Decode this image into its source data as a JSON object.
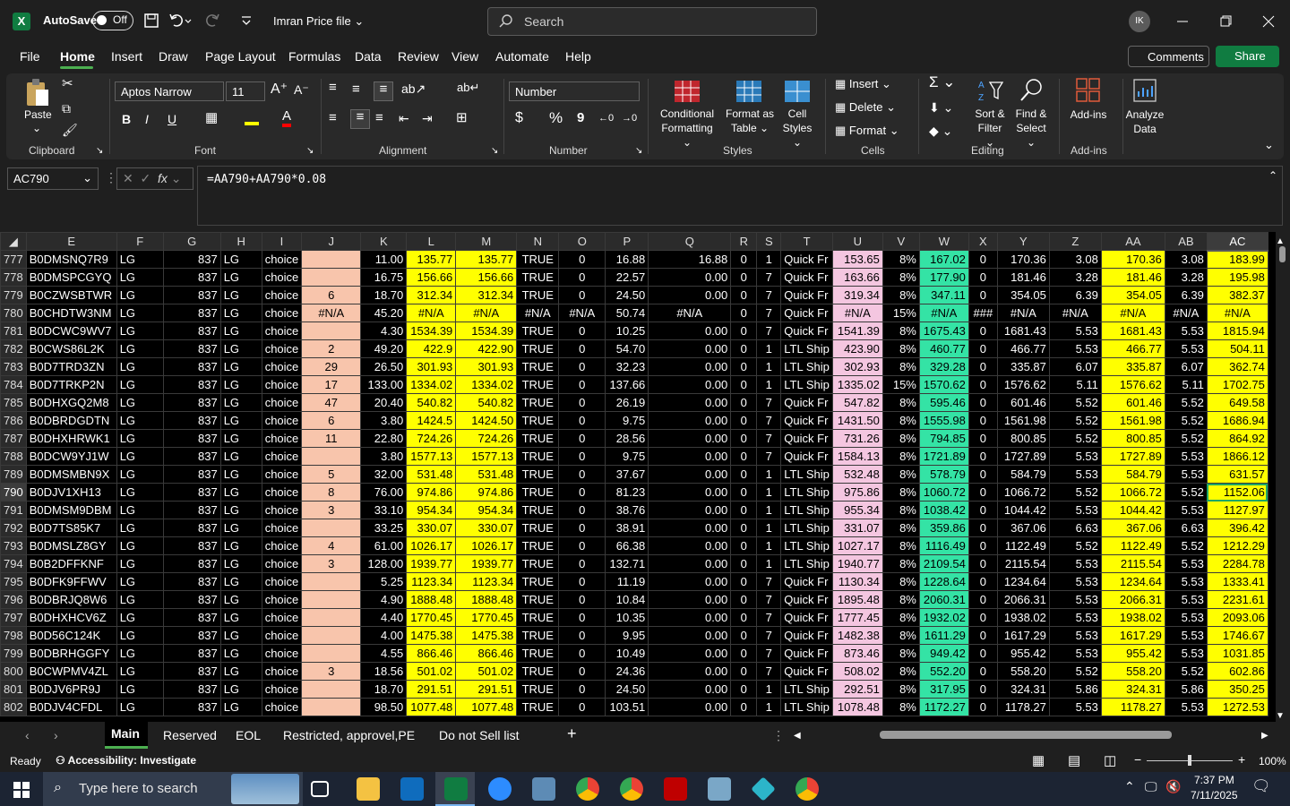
{
  "titlebar": {
    "app_icon": "X",
    "autosave_label": "AutoSave",
    "autosave_state": "Off",
    "filename": "Imran Price file",
    "search_placeholder": "Search",
    "avatar": "IK"
  },
  "menu": [
    "File",
    "Home",
    "Insert",
    "Draw",
    "Page Layout",
    "Formulas",
    "Data",
    "Review",
    "View",
    "Automate",
    "Help"
  ],
  "menu_buttons": {
    "comments": "Comments",
    "share": "Share"
  },
  "ribbon": {
    "clipboard": {
      "paste": "Paste",
      "label": "Clipboard"
    },
    "font": {
      "name": "Aptos Narrow",
      "size": "11",
      "label": "Font"
    },
    "alignment": {
      "label": "Alignment"
    },
    "number": {
      "format": "Number",
      "label": "Number",
      "currency": "$",
      "percent": "%",
      "comma": "9"
    },
    "styles": {
      "conditional": "Conditional",
      "conditional2": "Formatting",
      "format_table": "Format as",
      "format_table2": "Table",
      "cell_styles": "Cell",
      "cell_styles2": "Styles",
      "label": "Styles"
    },
    "cells": {
      "insert": "Insert",
      "delete": "Delete",
      "format": "Format",
      "label": "Cells"
    },
    "editing": {
      "sort": "Sort &",
      "sort2": "Filter",
      "find": "Find &",
      "find2": "Select",
      "label": "Editing"
    },
    "addins": {
      "addins": "Add-ins",
      "label": "Add-ins",
      "analyze": "Analyze",
      "analyze2": "Data"
    }
  },
  "formula_bar": {
    "cell": "AC790",
    "fx": "fx",
    "formula": "=AA790+AA790*0.08"
  },
  "columns": [
    "E",
    "F",
    "G",
    "H",
    "I",
    "J",
    "K",
    "L",
    "M",
    "N",
    "O",
    "P",
    "Q",
    "R",
    "S",
    "T",
    "U",
    "V",
    "W",
    "X",
    "Y",
    "Z",
    "AA",
    "AB",
    "AC"
  ],
  "rows": [
    {
      "r": "777",
      "d": [
        "B0DMSNQ7R9",
        "LG",
        "837",
        "LG",
        "choice",
        "",
        "11.00",
        "135.77",
        "135.77",
        "TRUE",
        "0",
        "16.88",
        "16.88",
        "0",
        "1",
        "Quick Fr",
        "153.65",
        "8%",
        "167.02",
        "0",
        "170.36",
        "3.08",
        "170.36",
        "3.08",
        "183.99"
      ]
    },
    {
      "r": "778",
      "d": [
        "B0DMSPCGYQ",
        "LG",
        "837",
        "LG",
        "choice",
        "",
        "16.75",
        "156.66",
        "156.66",
        "TRUE",
        "0",
        "22.57",
        "0.00",
        "0",
        "7",
        "Quick Fr",
        "163.66",
        "8%",
        "177.90",
        "0",
        "181.46",
        "3.28",
        "181.46",
        "3.28",
        "195.98"
      ]
    },
    {
      "r": "779",
      "d": [
        "B0CZWSBTWR",
        "LG",
        "837",
        "LG",
        "choice",
        "6",
        "18.70",
        "312.34",
        "312.34",
        "TRUE",
        "0",
        "24.50",
        "0.00",
        "0",
        "7",
        "Quick Fr",
        "319.34",
        "8%",
        "347.11",
        "0",
        "354.05",
        "6.39",
        "354.05",
        "6.39",
        "382.37"
      ]
    },
    {
      "r": "780",
      "d": [
        "B0CHDTW3NM",
        "LG",
        "837",
        "LG",
        "choice",
        "#N/A",
        "45.20",
        "#N/A",
        "#N/A",
        "#N/A",
        "#N/A",
        "50.74",
        "#N/A",
        "0",
        "7",
        "Quick Fr",
        "#N/A",
        "15%",
        "#N/A",
        "###",
        "#N/A",
        "#N/A",
        "#N/A",
        "#N/A",
        "#N/A"
      ]
    },
    {
      "r": "781",
      "d": [
        "B0DCWC9WV7",
        "LG",
        "837",
        "LG",
        "choice",
        "",
        "4.30",
        "1534.39",
        "1534.39",
        "TRUE",
        "0",
        "10.25",
        "0.00",
        "0",
        "7",
        "Quick Fr",
        "1541.39",
        "8%",
        "1675.43",
        "0",
        "1681.43",
        "5.53",
        "1681.43",
        "5.53",
        "1815.94"
      ]
    },
    {
      "r": "782",
      "d": [
        "B0CWS86L2K",
        "LG",
        "837",
        "LG",
        "choice",
        "2",
        "49.20",
        "422.9",
        "422.90",
        "TRUE",
        "0",
        "54.70",
        "0.00",
        "0",
        "1",
        "LTL Ship",
        "423.90",
        "8%",
        "460.77",
        "0",
        "466.77",
        "5.53",
        "466.77",
        "5.53",
        "504.11"
      ]
    },
    {
      "r": "783",
      "d": [
        "B0D7TRD3ZN",
        "LG",
        "837",
        "LG",
        "choice",
        "29",
        "26.50",
        "301.93",
        "301.93",
        "TRUE",
        "0",
        "32.23",
        "0.00",
        "0",
        "1",
        "LTL Ship",
        "302.93",
        "8%",
        "329.28",
        "0",
        "335.87",
        "6.07",
        "335.87",
        "6.07",
        "362.74"
      ]
    },
    {
      "r": "784",
      "d": [
        "B0D7TRKP2N",
        "LG",
        "837",
        "LG",
        "choice",
        "17",
        "133.00",
        "1334.02",
        "1334.02",
        "TRUE",
        "0",
        "137.66",
        "0.00",
        "0",
        "1",
        "LTL Ship",
        "1335.02",
        "15%",
        "1570.62",
        "0",
        "1576.62",
        "5.11",
        "1576.62",
        "5.11",
        "1702.75"
      ]
    },
    {
      "r": "785",
      "d": [
        "B0DHXGQ2M8",
        "LG",
        "837",
        "LG",
        "choice",
        "47",
        "20.40",
        "540.82",
        "540.82",
        "TRUE",
        "0",
        "26.19",
        "0.00",
        "0",
        "7",
        "Quick Fr",
        "547.82",
        "8%",
        "595.46",
        "0",
        "601.46",
        "5.52",
        "601.46",
        "5.52",
        "649.58"
      ]
    },
    {
      "r": "786",
      "d": [
        "B0DBRDGDTN",
        "LG",
        "837",
        "LG",
        "choice",
        "6",
        "3.80",
        "1424.5",
        "1424.50",
        "TRUE",
        "0",
        "9.75",
        "0.00",
        "0",
        "7",
        "Quick Fr",
        "1431.50",
        "8%",
        "1555.98",
        "0",
        "1561.98",
        "5.52",
        "1561.98",
        "5.52",
        "1686.94"
      ]
    },
    {
      "r": "787",
      "d": [
        "B0DHXHRWK1",
        "LG",
        "837",
        "LG",
        "choice",
        "11",
        "22.80",
        "724.26",
        "724.26",
        "TRUE",
        "0",
        "28.56",
        "0.00",
        "0",
        "7",
        "Quick Fr",
        "731.26",
        "8%",
        "794.85",
        "0",
        "800.85",
        "5.52",
        "800.85",
        "5.52",
        "864.92"
      ]
    },
    {
      "r": "788",
      "d": [
        "B0DCW9YJ1W",
        "LG",
        "837",
        "LG",
        "choice",
        "",
        "3.80",
        "1577.13",
        "1577.13",
        "TRUE",
        "0",
        "9.75",
        "0.00",
        "0",
        "7",
        "Quick Fr",
        "1584.13",
        "8%",
        "1721.89",
        "0",
        "1727.89",
        "5.53",
        "1727.89",
        "5.53",
        "1866.12"
      ]
    },
    {
      "r": "789",
      "d": [
        "B0DMSMBN9X",
        "LG",
        "837",
        "LG",
        "choice",
        "5",
        "32.00",
        "531.48",
        "531.48",
        "TRUE",
        "0",
        "37.67",
        "0.00",
        "0",
        "1",
        "LTL Ship",
        "532.48",
        "8%",
        "578.79",
        "0",
        "584.79",
        "5.53",
        "584.79",
        "5.53",
        "631.57"
      ]
    },
    {
      "r": "790",
      "d": [
        "B0DJV1XH13",
        "LG",
        "837",
        "LG",
        "choice",
        "8",
        "76.00",
        "974.86",
        "974.86",
        "TRUE",
        "0",
        "81.23",
        "0.00",
        "0",
        "1",
        "LTL Ship",
        "975.86",
        "8%",
        "1060.72",
        "0",
        "1066.72",
        "5.52",
        "1066.72",
        "5.52",
        "1152.06"
      ]
    },
    {
      "r": "791",
      "d": [
        "B0DMSM9DBM",
        "LG",
        "837",
        "LG",
        "choice",
        "3",
        "33.10",
        "954.34",
        "954.34",
        "TRUE",
        "0",
        "38.76",
        "0.00",
        "0",
        "1",
        "LTL Ship",
        "955.34",
        "8%",
        "1038.42",
        "0",
        "1044.42",
        "5.53",
        "1044.42",
        "5.53",
        "1127.97"
      ]
    },
    {
      "r": "792",
      "d": [
        "B0D7TS85K7",
        "LG",
        "837",
        "LG",
        "choice",
        "",
        "33.25",
        "330.07",
        "330.07",
        "TRUE",
        "0",
        "38.91",
        "0.00",
        "0",
        "1",
        "LTL Ship",
        "331.07",
        "8%",
        "359.86",
        "0",
        "367.06",
        "6.63",
        "367.06",
        "6.63",
        "396.42"
      ]
    },
    {
      "r": "793",
      "d": [
        "B0DMSLZ8GY",
        "LG",
        "837",
        "LG",
        "choice",
        "4",
        "61.00",
        "1026.17",
        "1026.17",
        "TRUE",
        "0",
        "66.38",
        "0.00",
        "0",
        "1",
        "LTL Ship",
        "1027.17",
        "8%",
        "1116.49",
        "0",
        "1122.49",
        "5.52",
        "1122.49",
        "5.52",
        "1212.29"
      ]
    },
    {
      "r": "794",
      "d": [
        "B0B2DFFKNF",
        "LG",
        "837",
        "LG",
        "choice",
        "3",
        "128.00",
        "1939.77",
        "1939.77",
        "TRUE",
        "0",
        "132.71",
        "0.00",
        "0",
        "1",
        "LTL Ship",
        "1940.77",
        "8%",
        "2109.54",
        "0",
        "2115.54",
        "5.53",
        "2115.54",
        "5.53",
        "2284.78"
      ]
    },
    {
      "r": "795",
      "d": [
        "B0DFK9FFWV",
        "LG",
        "837",
        "LG",
        "choice",
        "",
        "5.25",
        "1123.34",
        "1123.34",
        "TRUE",
        "0",
        "11.19",
        "0.00",
        "0",
        "7",
        "Quick Fr",
        "1130.34",
        "8%",
        "1228.64",
        "0",
        "1234.64",
        "5.53",
        "1234.64",
        "5.53",
        "1333.41"
      ]
    },
    {
      "r": "796",
      "d": [
        "B0DBRJQ8W6",
        "LG",
        "837",
        "LG",
        "choice",
        "",
        "4.90",
        "1888.48",
        "1888.48",
        "TRUE",
        "0",
        "10.84",
        "0.00",
        "0",
        "7",
        "Quick Fr",
        "1895.48",
        "8%",
        "2060.31",
        "0",
        "2066.31",
        "5.53",
        "2066.31",
        "5.53",
        "2231.61"
      ]
    },
    {
      "r": "797",
      "d": [
        "B0DHXHCV6Z",
        "LG",
        "837",
        "LG",
        "choice",
        "",
        "4.40",
        "1770.45",
        "1770.45",
        "TRUE",
        "0",
        "10.35",
        "0.00",
        "0",
        "7",
        "Quick Fr",
        "1777.45",
        "8%",
        "1932.02",
        "0",
        "1938.02",
        "5.53",
        "1938.02",
        "5.53",
        "2093.06"
      ]
    },
    {
      "r": "798",
      "d": [
        "B0D56C124K",
        "LG",
        "837",
        "LG",
        "choice",
        "",
        "4.00",
        "1475.38",
        "1475.38",
        "TRUE",
        "0",
        "9.95",
        "0.00",
        "0",
        "7",
        "Quick Fr",
        "1482.38",
        "8%",
        "1611.29",
        "0",
        "1617.29",
        "5.53",
        "1617.29",
        "5.53",
        "1746.67"
      ]
    },
    {
      "r": "799",
      "d": [
        "B0DBRHGGFY",
        "LG",
        "837",
        "LG",
        "choice",
        "",
        "4.55",
        "866.46",
        "866.46",
        "TRUE",
        "0",
        "10.49",
        "0.00",
        "0",
        "7",
        "Quick Fr",
        "873.46",
        "8%",
        "949.42",
        "0",
        "955.42",
        "5.53",
        "955.42",
        "5.53",
        "1031.85"
      ]
    },
    {
      "r": "800",
      "d": [
        "B0CWPMV4ZL",
        "LG",
        "837",
        "LG",
        "choice",
        "3",
        "18.56",
        "501.02",
        "501.02",
        "TRUE",
        "0",
        "24.36",
        "0.00",
        "0",
        "7",
        "Quick Fr",
        "508.02",
        "8%",
        "552.20",
        "0",
        "558.20",
        "5.52",
        "558.20",
        "5.52",
        "602.86"
      ]
    },
    {
      "r": "801",
      "d": [
        "B0DJV6PR9J",
        "LG",
        "837",
        "LG",
        "choice",
        "",
        "18.70",
        "291.51",
        "291.51",
        "TRUE",
        "0",
        "24.50",
        "0.00",
        "0",
        "1",
        "LTL Ship",
        "292.51",
        "8%",
        "317.95",
        "0",
        "324.31",
        "5.86",
        "324.31",
        "5.86",
        "350.25"
      ]
    },
    {
      "r": "802",
      "d": [
        "B0DJV4CFDL",
        "LG",
        "837",
        "LG",
        "choice",
        "",
        "98.50",
        "1077.48",
        "1077.48",
        "TRUE",
        "0",
        "103.51",
        "0.00",
        "0",
        "1",
        "LTL Ship",
        "1078.48",
        "8%",
        "1172.27",
        "0",
        "1178.27",
        "5.53",
        "1178.27",
        "5.53",
        "1272.53"
      ]
    }
  ],
  "sheet_tabs": [
    "Main",
    "Reserved",
    "EOL",
    "Restricted, approvel,PE",
    "Do not Sell list"
  ],
  "status": {
    "ready": "Ready",
    "accessibility": "Accessibility: Investigate",
    "zoom": "100%"
  },
  "taskbar": {
    "search_placeholder": "Type here to search",
    "time": "7:37 PM",
    "date": "7/11/2025"
  },
  "colors": {
    "yellow": "#ffff00",
    "peach": "#f8c5ac",
    "pink": "#f4c6e0",
    "green": "#34e3a5",
    "accent": "#107c41"
  }
}
